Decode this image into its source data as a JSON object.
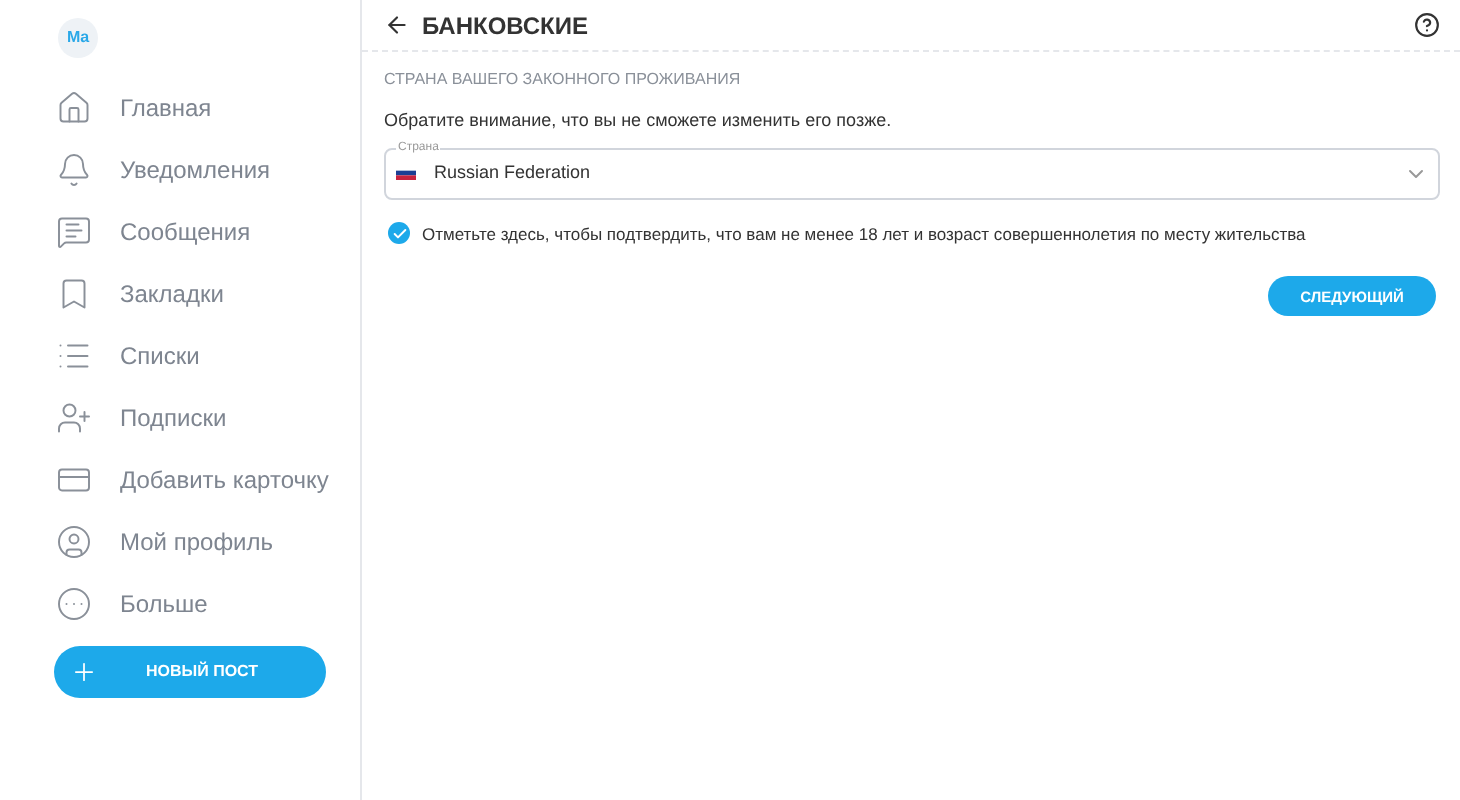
{
  "sidebar": {
    "avatar": "Ma",
    "items": [
      {
        "label": "Главная"
      },
      {
        "label": "Уведомления"
      },
      {
        "label": "Сообщения"
      },
      {
        "label": "Закладки"
      },
      {
        "label": "Списки"
      },
      {
        "label": "Подписки"
      },
      {
        "label": "Добавить карточку"
      },
      {
        "label": "Мой профиль"
      },
      {
        "label": "Больше"
      }
    ],
    "new_post": "НОВЫЙ ПОСТ"
  },
  "header": {
    "title": "БАНКОВСКИЕ"
  },
  "form": {
    "section_label": "СТРАНА ВАШЕГО ЗАКОННОГО ПРОЖИВАНИЯ",
    "note": "Обратите внимание, что вы не сможете изменить его позже.",
    "country_field": {
      "label": "Страна",
      "value": "Russian Federation"
    },
    "confirm": {
      "label": "Отметьте здесь, чтобы подтвердить, что вам не менее 18 лет и возраст совершеннолетия по месту жительства",
      "checked": true
    },
    "next_button": "СЛЕДУЮЩИЙ"
  }
}
